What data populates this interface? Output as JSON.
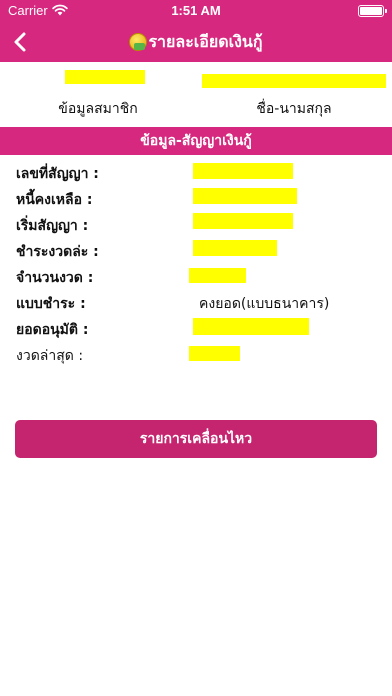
{
  "status_bar": {
    "carrier": "Carrier",
    "time": "1:51 AM"
  },
  "nav": {
    "title": "รายละเอียดเงินกู้",
    "back_icon": "chevron-left-icon",
    "title_icon": "money-coin-icon"
  },
  "member": {
    "member_label": "ข้อมูลสมาชิก",
    "name_label": "ชื่อ-นามสกุล"
  },
  "section": {
    "title": "ข้อมูล-สัญญาเงินกู้"
  },
  "details": {
    "contract_no_label": "เลขที่สัญญา :",
    "balance_label": "หนี้คงเหลือ :",
    "start_label": "เริ่มสัญญา :",
    "installment_label": "ชำระงวดล่ะ :",
    "periods_label": "จำนวนงวด :",
    "pay_type_label": "แบบชำระ :",
    "pay_type_value": "คงยอด(แบบธนาคาร)",
    "approved_label": "ยอดอนุมัติ :",
    "last_period_label": "งวดล่าสุด :"
  },
  "actions": {
    "movement_button": "รายการเคลื่อนไหว"
  },
  "colors": {
    "brand": "#d6287f",
    "button": "#c5246f",
    "redaction": "#ffff00"
  }
}
